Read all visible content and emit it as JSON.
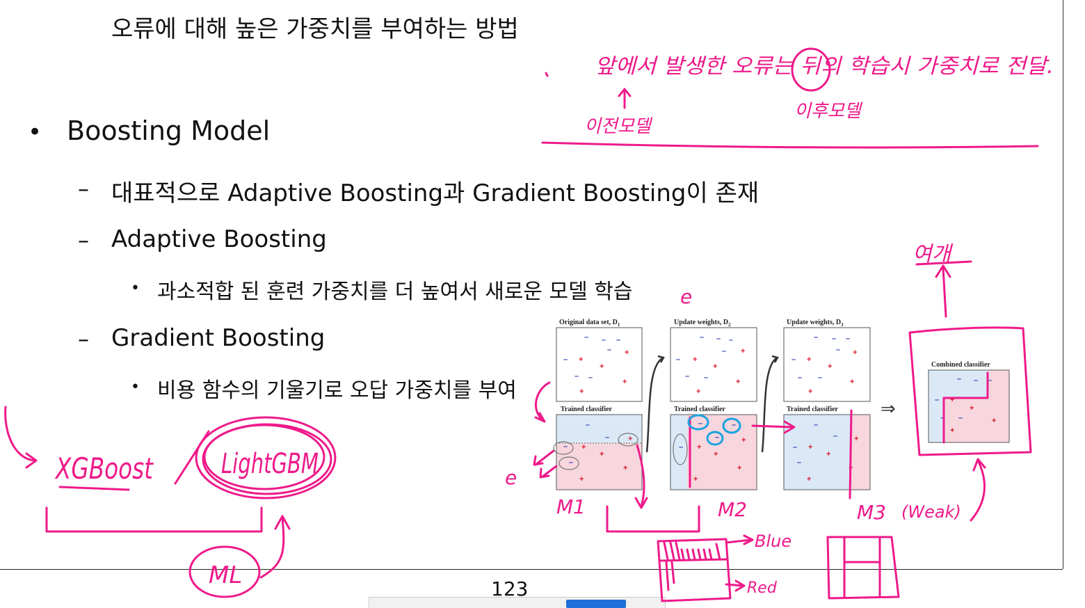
{
  "slide": {
    "title_line": "오류에 대해 높은 가중치를 부여하는 방법",
    "bullet_symbol": "•",
    "bullet_main": "Boosting Model",
    "dash_symbol": "–",
    "sub1": "대표적으로 Adaptive Boosting과 Gradient Boosting이 존재",
    "sub2": "Adaptive Boosting",
    "sub2_detail": "과소적합 된 훈련 가중치를 더 높여서 새로운 모델 학습",
    "sub3": "Gradient Boosting",
    "sub3_detail": "비용 함수의 기울기로 오답 가중치를 부여"
  },
  "figure": {
    "panel1_top": "Original data set,  D",
    "panel1_top_sub": "1",
    "panel2_top": "Update weights,  D",
    "panel2_top_sub": "2",
    "panel3_top": "Update weights,  D",
    "panel3_top_sub": "3",
    "trained_label": "Trained classifier",
    "combined_label": "Combined classifier",
    "arrow_symbol": "⇒",
    "plus": "+",
    "minus": "–"
  },
  "annotations": {
    "xgboost": "XGBoost",
    "lightgbm": "LightGBM",
    "ml": "ML",
    "m1": "M1",
    "m2": "M2",
    "m3": "M3",
    "weak": "(Weak)",
    "blue": "Blue",
    "red": "Red",
    "e": "e",
    "top_note": "앞에서 발생한 오류는 뒤의 학습시 가중치로 전달.",
    "top_note_sub1": "이전모델",
    "top_note_sub2": "이후모델",
    "strong": "여개",
    "ink_color": "#ee1a8a"
  },
  "footer": {
    "page_number": "123"
  }
}
